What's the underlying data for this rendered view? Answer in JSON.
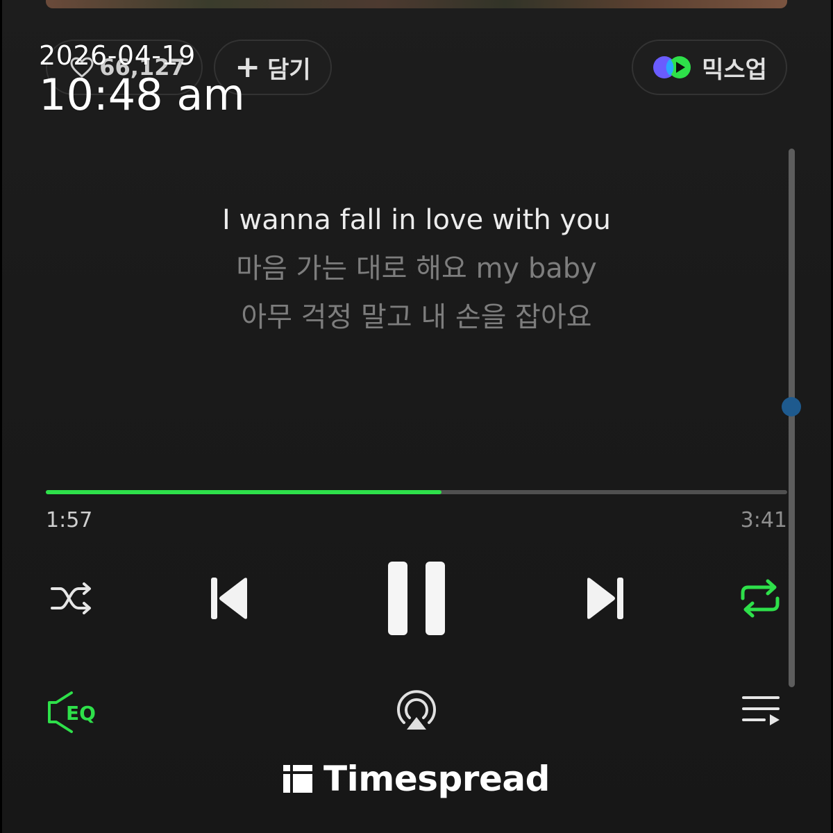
{
  "status": {
    "date": "2026-04-19",
    "time": "10:48 am"
  },
  "actions": {
    "like_count": "66,127",
    "add_label": "담기",
    "mixup_label": "믹스업"
  },
  "lyrics": [
    "I wanna fall in love with you",
    "마음 가는 대로 해요 my baby",
    "아무 걱정 말고 내 손을 잡아요"
  ],
  "player": {
    "current_time": "1:57",
    "total_time": "3:41",
    "progress": 0.534,
    "lyric_scroll": 0.48,
    "shuffle": "off",
    "repeat": "on",
    "state": "playing"
  },
  "bottom": {
    "eq_label": "EQ"
  },
  "watermark": {
    "brand": "Timespread"
  },
  "colors": {
    "accent_green": "#2ee04a",
    "background": "#181818",
    "scroll_thumb": "#1e5a8e"
  },
  "icons": [
    "heart-icon",
    "plus-icon",
    "mixup-icon",
    "shuffle-icon",
    "previous-icon",
    "pause-icon",
    "next-icon",
    "repeat-icon",
    "eq-icon",
    "airplay-icon",
    "playlist-icon",
    "timespread-logo-icon"
  ]
}
